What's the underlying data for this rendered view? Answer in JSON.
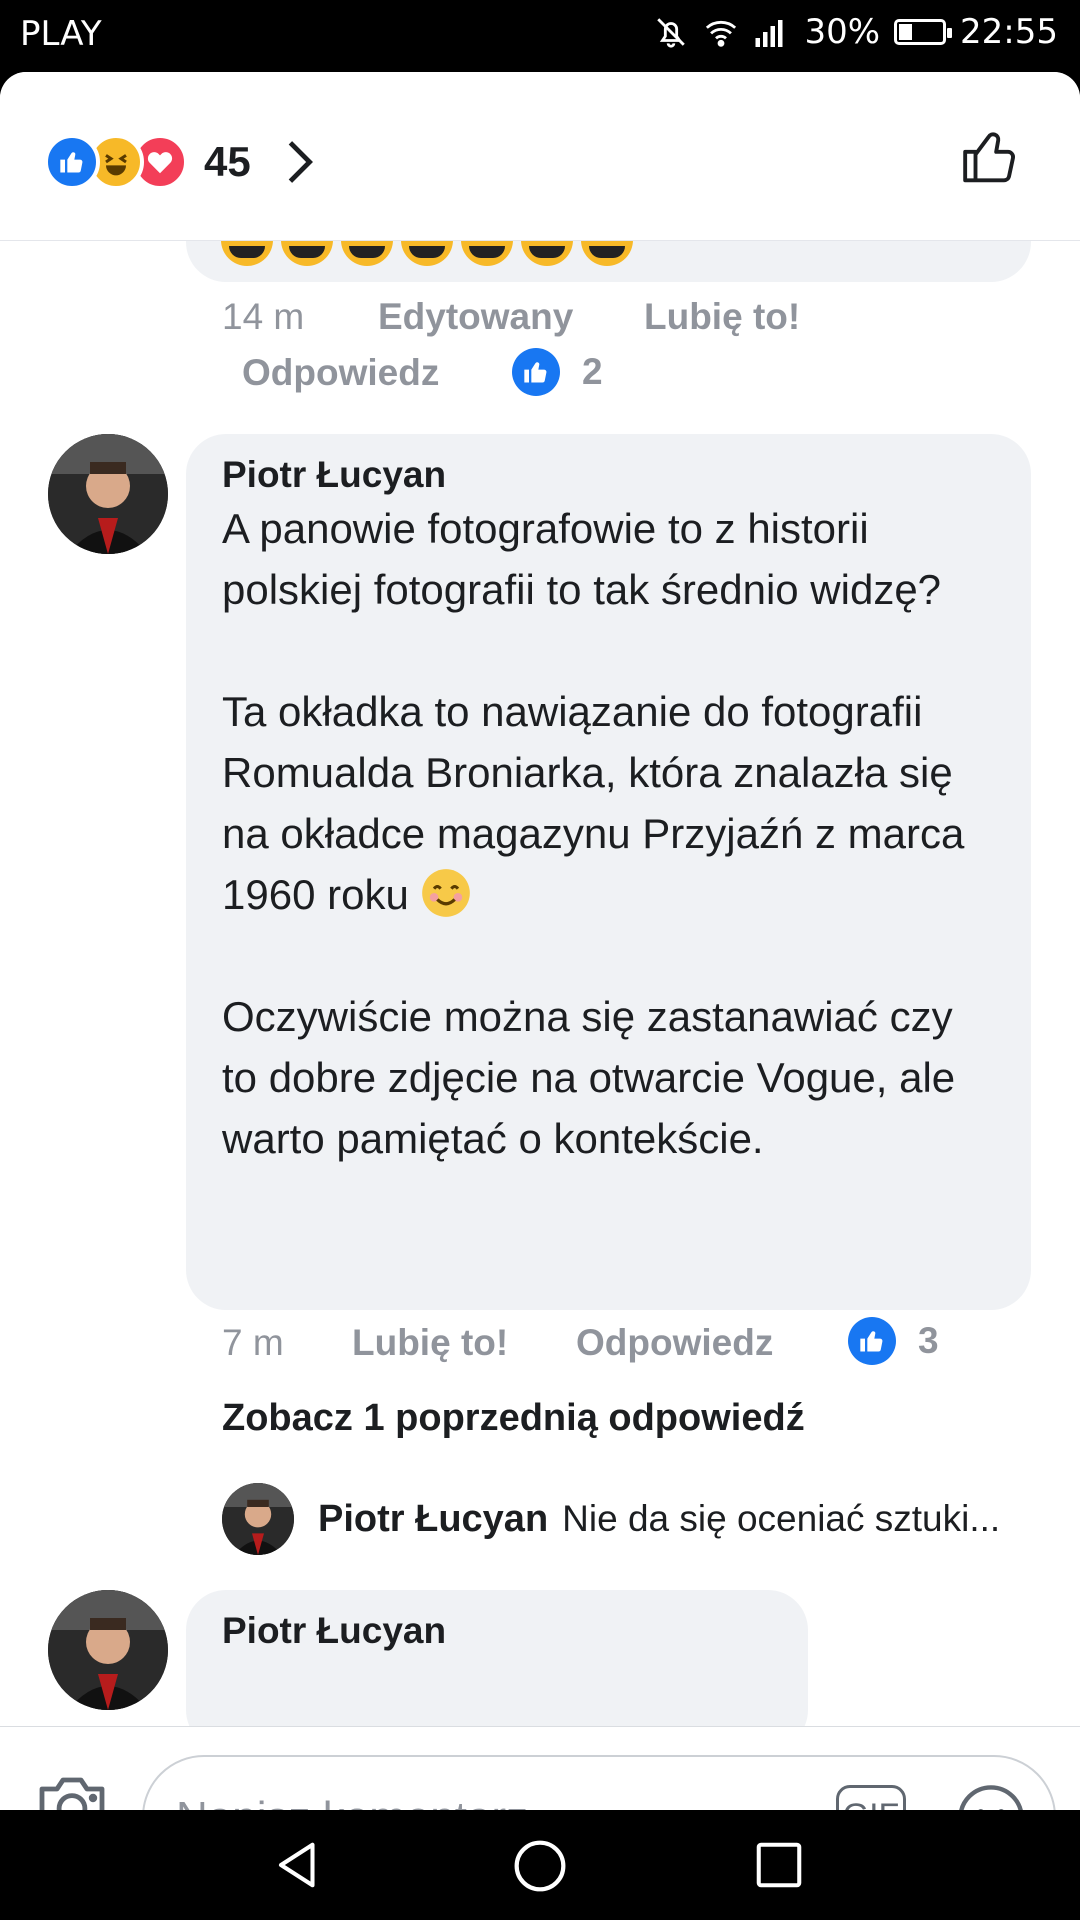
{
  "status_bar": {
    "carrier": "PLAY",
    "battery": "30%",
    "time": "22:55",
    "battery_level": 0.3
  },
  "header": {
    "reaction_count": "45",
    "reactions": [
      "like-icon",
      "haha-icon",
      "love-icon"
    ]
  },
  "comments": [
    {
      "time": "14 m",
      "edited": "Edytowany",
      "like_label": "Lubię to!",
      "reply_label": "Odpowiedz",
      "like_count": "2"
    },
    {
      "author": "Piotr Łucyan",
      "paragraphs": [
        "A panowie fotografowie to z historii polskiej fotografii to tak średnio widzę?",
        "Ta okładka to nawiązanie do fotografii Romualda Broniarka, która znalazła się na okładce magazynu Przyjaźń z marca 1960 roku",
        "Oczywiście można się zastanawiać czy to dobre zdjęcie na otwarcie Vogue, ale warto pamiętać o kontekście."
      ],
      "time": "7 m",
      "like_label": "Lubię to!",
      "reply_label": "Odpowiedz",
      "like_count": "3",
      "see_previous": "Zobacz 1 poprzednią odpowiedź",
      "reply": {
        "author": "Piotr Łucyan",
        "text": "Nie da się oceniać sztuki..."
      }
    },
    {
      "author": "Piotr Łucyan"
    }
  ],
  "composer": {
    "placeholder": "Napisz komentarz...",
    "gif_label": "GIF"
  },
  "colors": {
    "accent": "#1877f2",
    "bubble": "#f0f2f5",
    "meta": "#90949c",
    "haha": "#f7b928",
    "love": "#f33e58"
  }
}
